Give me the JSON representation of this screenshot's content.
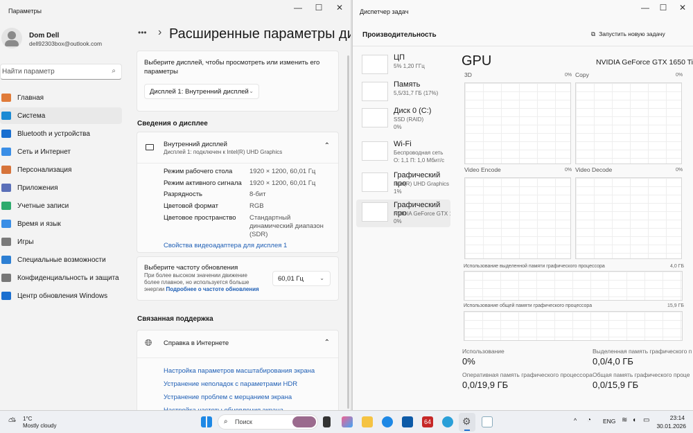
{
  "settings": {
    "title": "Параметры",
    "user": {
      "name": "Dom Dell",
      "email": "dell92303box@outlook.com"
    },
    "search_placeholder": "Найти параметр",
    "nav": [
      "Главная",
      "Система",
      "Bluetooth и устройства",
      "Сеть и Интернет",
      "Персонализация",
      "Приложения",
      "Учетные записи",
      "Время и язык",
      "Игры",
      "Специальные возможности",
      "Конфиденциальность и защита",
      "Центр обновления Windows"
    ],
    "breadcrumb_more": "•••",
    "page_title": "Расширенные параметры ди",
    "select_display_text": "Выберите дисплей, чтобы просмотреть или изменить его параметры",
    "display_dropdown": "Дисплей 1: Внутренний дисплей",
    "display_info_heading": "Сведения о дисплее",
    "display_name": "Внутренний дисплей",
    "display_sub": "Дисплей 1: подключен к Intel(R) UHD Graphics",
    "rows": [
      {
        "label": "Режим рабочего стола",
        "value": "1920 × 1200, 60,01 Гц"
      },
      {
        "label": "Режим активного сигнала",
        "value": "1920 × 1200, 60,01 Гц"
      },
      {
        "label": "Разрядность",
        "value": "8-бит"
      },
      {
        "label": "Цветовой формат",
        "value": "RGB"
      },
      {
        "label": "Цветовое пространство",
        "value": "Стандартный динамический диапазон (SDR)"
      }
    ],
    "adapter_link": "Свойства видеоадаптера для дисплея 1",
    "refresh_title": "Выберите частоту обновления",
    "refresh_desc": "При более высоком значении движение более плавное, но используется больше энергии",
    "refresh_link": "Подробнее о частоте обновления",
    "refresh_value": "60,01 Гц",
    "support_heading": "Связанная поддержка",
    "help_title": "Справка в Интернете",
    "help_links": [
      "Настройка параметров масштабирования экрана",
      "Устранение неполадок с параметрами HDR",
      "Устранение проблем с мерцанием экрана",
      "Настройка частоты обновления экрана"
    ]
  },
  "taskmgr": {
    "title": "Диспетчер задач",
    "section": "Производительность",
    "run_task": "Запустить новую задачу",
    "items": [
      {
        "title": "ЦП",
        "sub": [
          "5% 1,20 ГГц"
        ]
      },
      {
        "title": "Память",
        "sub": [
          "5,5/31,7 ГБ (17%)"
        ]
      },
      {
        "title": "Диск 0 (C:)",
        "sub": [
          "SSD (RAID)",
          "0%"
        ]
      },
      {
        "title": "Wi-Fi",
        "sub": [
          "Беспроводная сеть",
          "О: 1,1 П: 1,0 Мбит/с"
        ]
      },
      {
        "title": "Графический про",
        "sub": [
          "Intel(R) UHD Graphics",
          "1%"
        ]
      },
      {
        "title": "Графический про",
        "sub": [
          "NVIDIA GeForce GTX 16",
          "0%"
        ]
      }
    ],
    "gpu_title": "GPU",
    "gpu_name": "NVIDIA GeForce GTX 1650 Ti",
    "engines": [
      {
        "name": "3D",
        "pct": "0%"
      },
      {
        "name": "Copy",
        "pct": "0%"
      },
      {
        "name": "Video Encode",
        "pct": "0%"
      },
      {
        "name": "Video Decode",
        "pct": "0%"
      }
    ],
    "dedicated_label": "Использование выделенной памяти графического процессора",
    "dedicated_max": "4,0 ГБ",
    "shared_label": "Использование общей памяти графического процессора",
    "shared_max": "15,9 ГБ",
    "stats": [
      {
        "label": "Использование",
        "value": "0%"
      },
      {
        "label": "Выделенная память графического п",
        "value": "0,0/4,0 ГБ"
      },
      {
        "label": "Оперативная память графического процессора",
        "value": "0,0/19,9 ГБ"
      },
      {
        "label": "Общая память графического проце",
        "value": "0,0/15,9 ГБ"
      }
    ]
  },
  "taskbar": {
    "temp": "1°C",
    "weather": "Mostly cloudy",
    "search": "Поиск",
    "lang": "ENG",
    "time": "23:14",
    "date": "30.01.2026",
    "badge": "64"
  }
}
